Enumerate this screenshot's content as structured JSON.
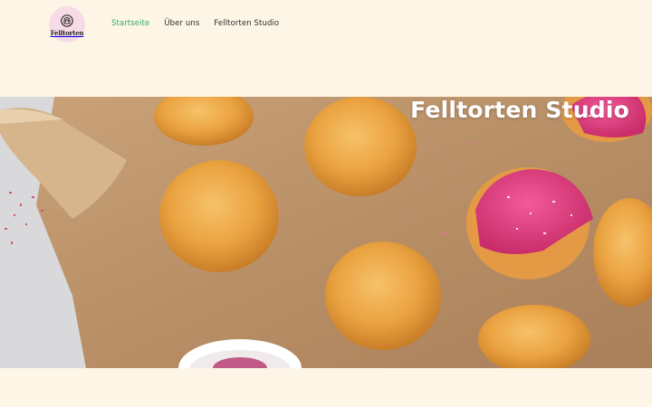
{
  "logo": {
    "text": "Felltorten"
  },
  "nav": {
    "items": [
      {
        "label": "Startseite",
        "active": true
      },
      {
        "label": "Über uns",
        "active": false
      },
      {
        "label": "Felltorten Studio",
        "active": false
      }
    ]
  },
  "hero": {
    "title": "Felltorten Studio"
  },
  "colors": {
    "background": "#fdf6e6",
    "accent": "#2faa63",
    "logo_bg": "#f7dbe6"
  }
}
